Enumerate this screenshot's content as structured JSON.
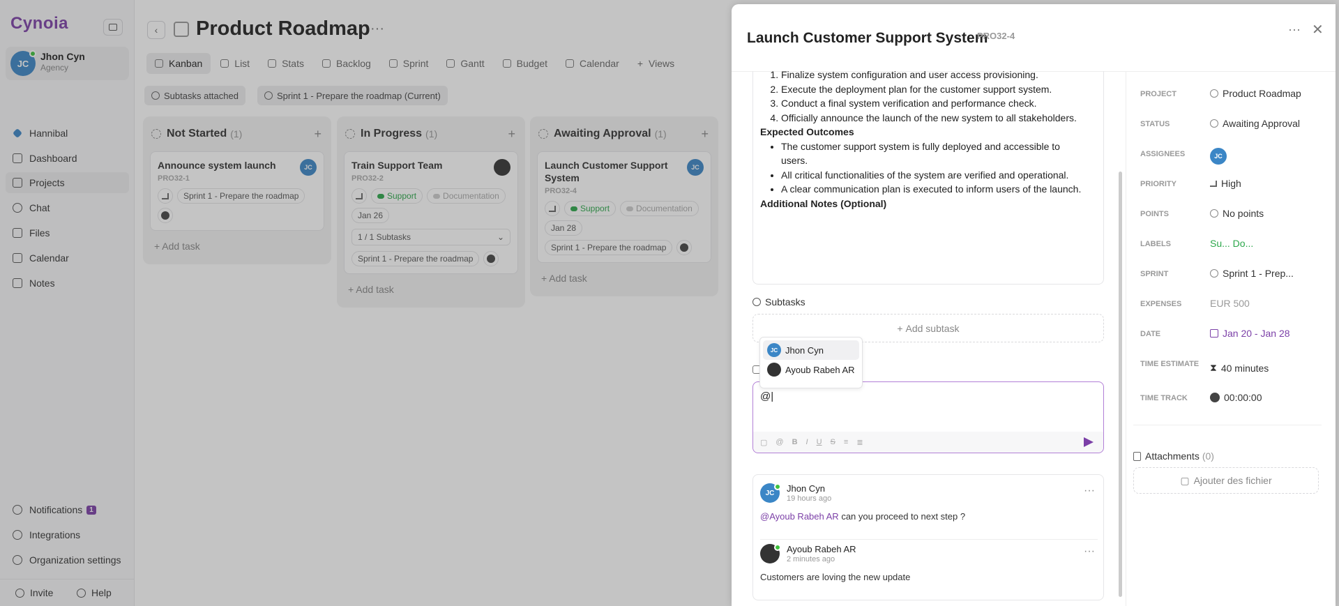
{
  "app": {
    "logo": "Cynoia",
    "user_name": "Jhon Cyn",
    "user_role": "Agency",
    "user_initials": "JC"
  },
  "sidebar": {
    "items": [
      {
        "label": "Hannibal"
      },
      {
        "label": "Dashboard"
      },
      {
        "label": "Projects"
      },
      {
        "label": "Chat"
      },
      {
        "label": "Files"
      },
      {
        "label": "Calendar"
      },
      {
        "label": "Notes"
      }
    ],
    "notifications_label": "Notifications",
    "notifications_count": "1",
    "integrations_label": "Integrations",
    "org_settings_label": "Organization settings",
    "invite_label": "Invite",
    "help_label": "Help"
  },
  "header": {
    "title": "Product Roadmap"
  },
  "tabs": [
    "Kanban",
    "List",
    "Stats",
    "Backlog",
    "Sprint",
    "Gantt",
    "Budget",
    "Calendar",
    "Views"
  ],
  "filters": {
    "subtasks": "Subtasks attached",
    "sprint": "Sprint 1 - Prepare the roadmap (Current)"
  },
  "columns": [
    {
      "title": "Not Started",
      "count": "(1)",
      "add_task": "Add task",
      "card": {
        "title": "Announce system launch",
        "code": "PRO32-1",
        "sprint": "Sprint 1 - Prepare the roadmap"
      }
    },
    {
      "title": "In Progress",
      "count": "(1)",
      "add_task": "Add task",
      "card": {
        "title": "Train Support Team",
        "code": "PRO32-2",
        "label1": "Support",
        "label2": "Documentation",
        "date": "Jan 26",
        "subtasks": "1 / 1 Subtasks",
        "sprint": "Sprint 1 - Prepare the roadmap"
      }
    },
    {
      "title": "Awaiting Approval",
      "count": "(1)",
      "add_task": "Add task",
      "card": {
        "title": "Launch Customer Support System",
        "code": "PRO32-4",
        "label1": "Support",
        "label2": "Documentation",
        "date": "Jan 28",
        "sprint": "Sprint 1 - Prepare the roadmap"
      }
    }
  ],
  "panel": {
    "title": "Launch Customer Support System",
    "code": "PRO32-4",
    "description": {
      "steps": [
        "Finalize system configuration and user access provisioning.",
        "Execute the deployment plan for the customer support system.",
        "Conduct a final system verification and performance check.",
        "Officially announce the launch of the new system to all stakeholders."
      ],
      "outcomes_heading": "Expected Outcomes",
      "outcomes": [
        "The customer support system is fully deployed and accessible to users.",
        "All critical functionalities of the system are verified and operational.",
        "A clear communication plan is executed to inform users of the launch."
      ],
      "notes_heading": "Additional Notes (Optional)"
    },
    "subtasks_label": "Subtasks",
    "add_subtask": "Add subtask",
    "mention_options": [
      {
        "name": "Jhon Cyn",
        "initials": "JC"
      },
      {
        "name": "Ayoub Rabeh AR",
        "initials": "AR"
      }
    ],
    "editor_value": "@|",
    "comments": [
      {
        "author": "Jhon Cyn",
        "initials": "JC",
        "time": "19 hours ago",
        "mention": "@Ayoub Rabeh AR",
        "text": " can you proceed to next step ?"
      },
      {
        "author": "Ayoub Rabeh AR",
        "initials": "AR",
        "time": "2 minutes ago",
        "text": "Customers are loving the new update"
      }
    ],
    "properties": [
      {
        "key": "PROJECT",
        "value": "Product Roadmap"
      },
      {
        "key": "STATUS",
        "value": "Awaiting Approval"
      },
      {
        "key": "ASSIGNEES",
        "value": "JC"
      },
      {
        "key": "PRIORITY",
        "value": "High"
      },
      {
        "key": "POINTS",
        "value": "No points"
      },
      {
        "key": "LABELS",
        "value": "Su...  Do..."
      },
      {
        "key": "SPRINT",
        "value": "Sprint 1 - Prep..."
      },
      {
        "key": "EXPENSES",
        "value": "EUR 500"
      },
      {
        "key": "DATE",
        "value": "Jan 20  -  Jan 28"
      },
      {
        "key": "TIME ESTIMATE",
        "value": "40 minutes"
      },
      {
        "key": "TIME TRACK",
        "value": "00:00:00"
      }
    ],
    "attachments_label": "Attachments",
    "attachments_count": "(0)",
    "add_file": "Ajouter des fichier"
  },
  "colors": {
    "accent": "#7b3fa7",
    "avatar": "#3b86c6",
    "label_green": "#2ba74a"
  }
}
